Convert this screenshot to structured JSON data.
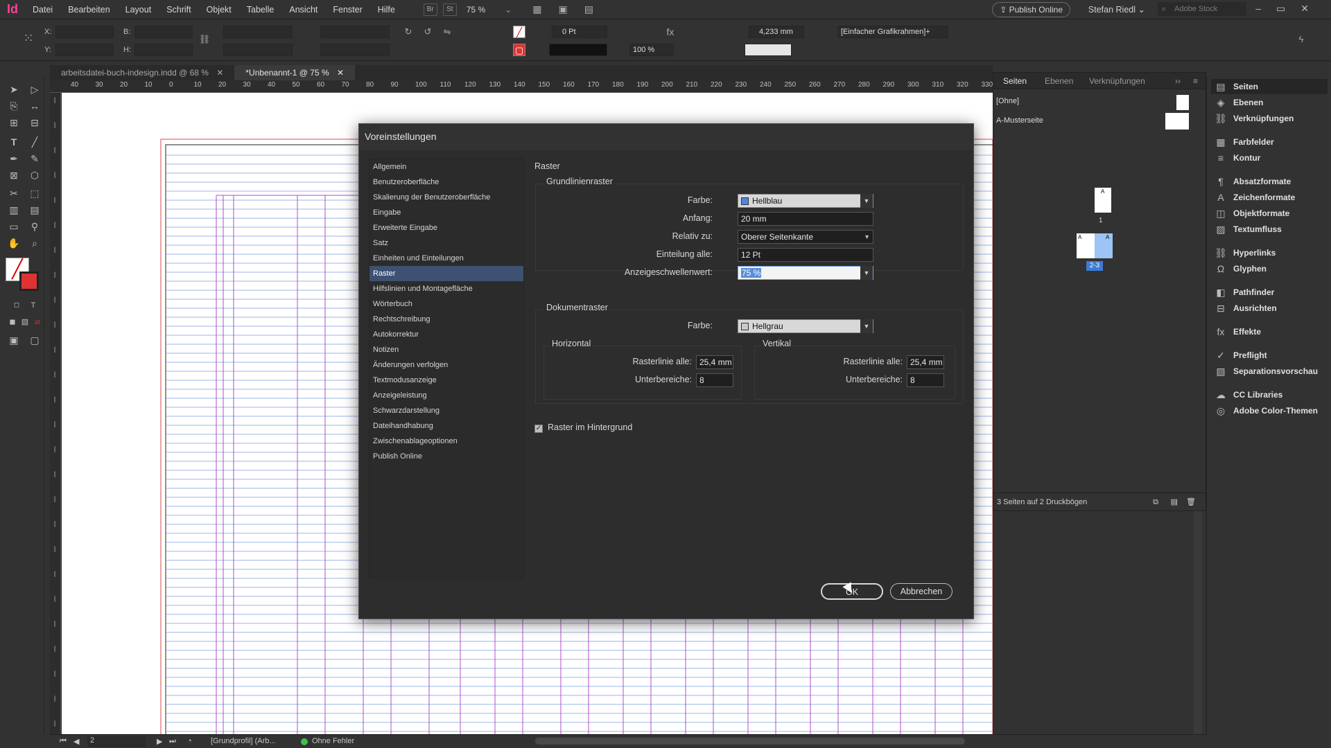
{
  "app": {
    "logo": "Id",
    "menu": [
      "Datei",
      "Bearbeiten",
      "Layout",
      "Schrift",
      "Objekt",
      "Tabelle",
      "Ansicht",
      "Fenster",
      "Hilfe"
    ],
    "bridge_label": "Br",
    "stock_label": "St",
    "zoom": "75 %",
    "publish_online": "Publish Online",
    "user": "Stefan Riedl",
    "search_placeholder": "Adobe Stock"
  },
  "control": {
    "x_label": "X:",
    "y_label": "Y:",
    "b_label": "B:",
    "h_label": "H:",
    "stroke_weight": "0 Pt",
    "scale_percent": "100 %",
    "dimension": "4,233 mm",
    "frame_style": "[Einfacher Grafikrahmen]+"
  },
  "doc_tabs": [
    {
      "label": "arbeitsdatei-buch-indesign.indd @ 68 %"
    },
    {
      "label": "*Unbenannt-1 @ 75 %"
    }
  ],
  "ruler_h_labels": [
    "40",
    "30",
    "20",
    "10",
    "0",
    "10",
    "20",
    "30",
    "40",
    "50",
    "60",
    "70",
    "80",
    "90",
    "100",
    "110",
    "120",
    "130",
    "140",
    "150",
    "160",
    "170",
    "180",
    "190",
    "200",
    "210",
    "220",
    "230",
    "240",
    "250",
    "260",
    "270",
    "280",
    "290",
    "300",
    "310",
    "320",
    "330"
  ],
  "dialog": {
    "title": "Voreinstellungen",
    "nav": [
      "Allgemein",
      "Benutzeroberfläche",
      "Skalierung der Benutzeroberfläche",
      "Eingabe",
      "Erweiterte Eingabe",
      "Satz",
      "Einheiten und Einteilungen",
      "Raster",
      "Hilfslinien und Montagefläche",
      "Wörterbuch",
      "Rechtschreibung",
      "Autokorrektur",
      "Notizen",
      "Änderungen verfolgen",
      "Textmodusanzeige",
      "Anzeigeleistung",
      "Schwarzdarstellung",
      "Dateihandhabung",
      "Zwischenablageoptionen",
      "Publish Online"
    ],
    "nav_active_index": 7,
    "section_title": "Raster",
    "baseline": {
      "title": "Grundlinienraster",
      "farbe_label": "Farbe:",
      "farbe_value": "Hellblau",
      "farbe_swatch": "#4f86e0",
      "anfang_label": "Anfang:",
      "anfang_value": "20 mm",
      "relativ_label": "Relativ zu:",
      "relativ_value": "Oberer Seitenkante",
      "einteilung_label": "Einteilung alle:",
      "einteilung_value": "12 Pt",
      "schwelle_label": "Anzeigeschwellenwert:",
      "schwelle_value": "75 %"
    },
    "document": {
      "title": "Dokumentraster",
      "farbe_label": "Farbe:",
      "farbe_value": "Hellgrau",
      "farbe_swatch": "#c9c9c9",
      "horizontal_title": "Horizontal",
      "vertikal_title": "Vertikal",
      "rasterlinie_label": "Rasterlinie alle:",
      "h_rasterlinie": "25,4 mm",
      "v_rasterlinie": "25,4 mm",
      "unterbereiche_label": "Unterbereiche:",
      "h_unterbereiche": "8",
      "v_unterbereiche": "8"
    },
    "background_checkbox": "Raster im Hintergrund",
    "ok": "OK",
    "cancel": "Abbrechen"
  },
  "pages_panel": {
    "tabs": [
      "Seiten",
      "Ebenen",
      "Verknüpfungen"
    ],
    "none_label": "[Ohne]",
    "master_label": "A-Musterseite",
    "page1": "1",
    "spread_label": "2-3",
    "footer": "3 Seiten auf 2 Druckbögen"
  },
  "dock": [
    {
      "label": "Seiten",
      "icon": "pages-icon"
    },
    {
      "label": "Ebenen",
      "icon": "layers-icon"
    },
    {
      "label": "Verknüpfungen",
      "icon": "links-icon"
    },
    {
      "label": "Farbfelder",
      "icon": "swatches-icon"
    },
    {
      "label": "Kontur",
      "icon": "stroke-icon"
    },
    {
      "label": "Absatzformate",
      "icon": "paragraph-styles-icon"
    },
    {
      "label": "Zeichenformate",
      "icon": "character-styles-icon"
    },
    {
      "label": "Objektformate",
      "icon": "object-styles-icon"
    },
    {
      "label": "Textumfluss",
      "icon": "text-wrap-icon"
    },
    {
      "label": "Hyperlinks",
      "icon": "hyperlinks-icon"
    },
    {
      "label": "Glyphen",
      "icon": "glyphs-icon"
    },
    {
      "label": "Pathfinder",
      "icon": "pathfinder-icon"
    },
    {
      "label": "Ausrichten",
      "icon": "align-icon"
    },
    {
      "label": "Effekte",
      "icon": "effects-icon"
    },
    {
      "label": "Preflight",
      "icon": "preflight-icon"
    },
    {
      "label": "Separationsvorschau",
      "icon": "separations-icon"
    },
    {
      "label": "CC Libraries",
      "icon": "cc-libraries-icon"
    },
    {
      "label": "Adobe Color-Themen",
      "icon": "color-themes-icon"
    }
  ],
  "status": {
    "page": "2",
    "profile": "[Grundprofil] (Arb...",
    "preflight": "Ohne Fehler"
  },
  "colors": {
    "accent": "#3d5272",
    "baseline_grid": "#9ab4e8",
    "margin_guide": "#b04cc8",
    "preflight_ok": "#3fbf4f"
  }
}
